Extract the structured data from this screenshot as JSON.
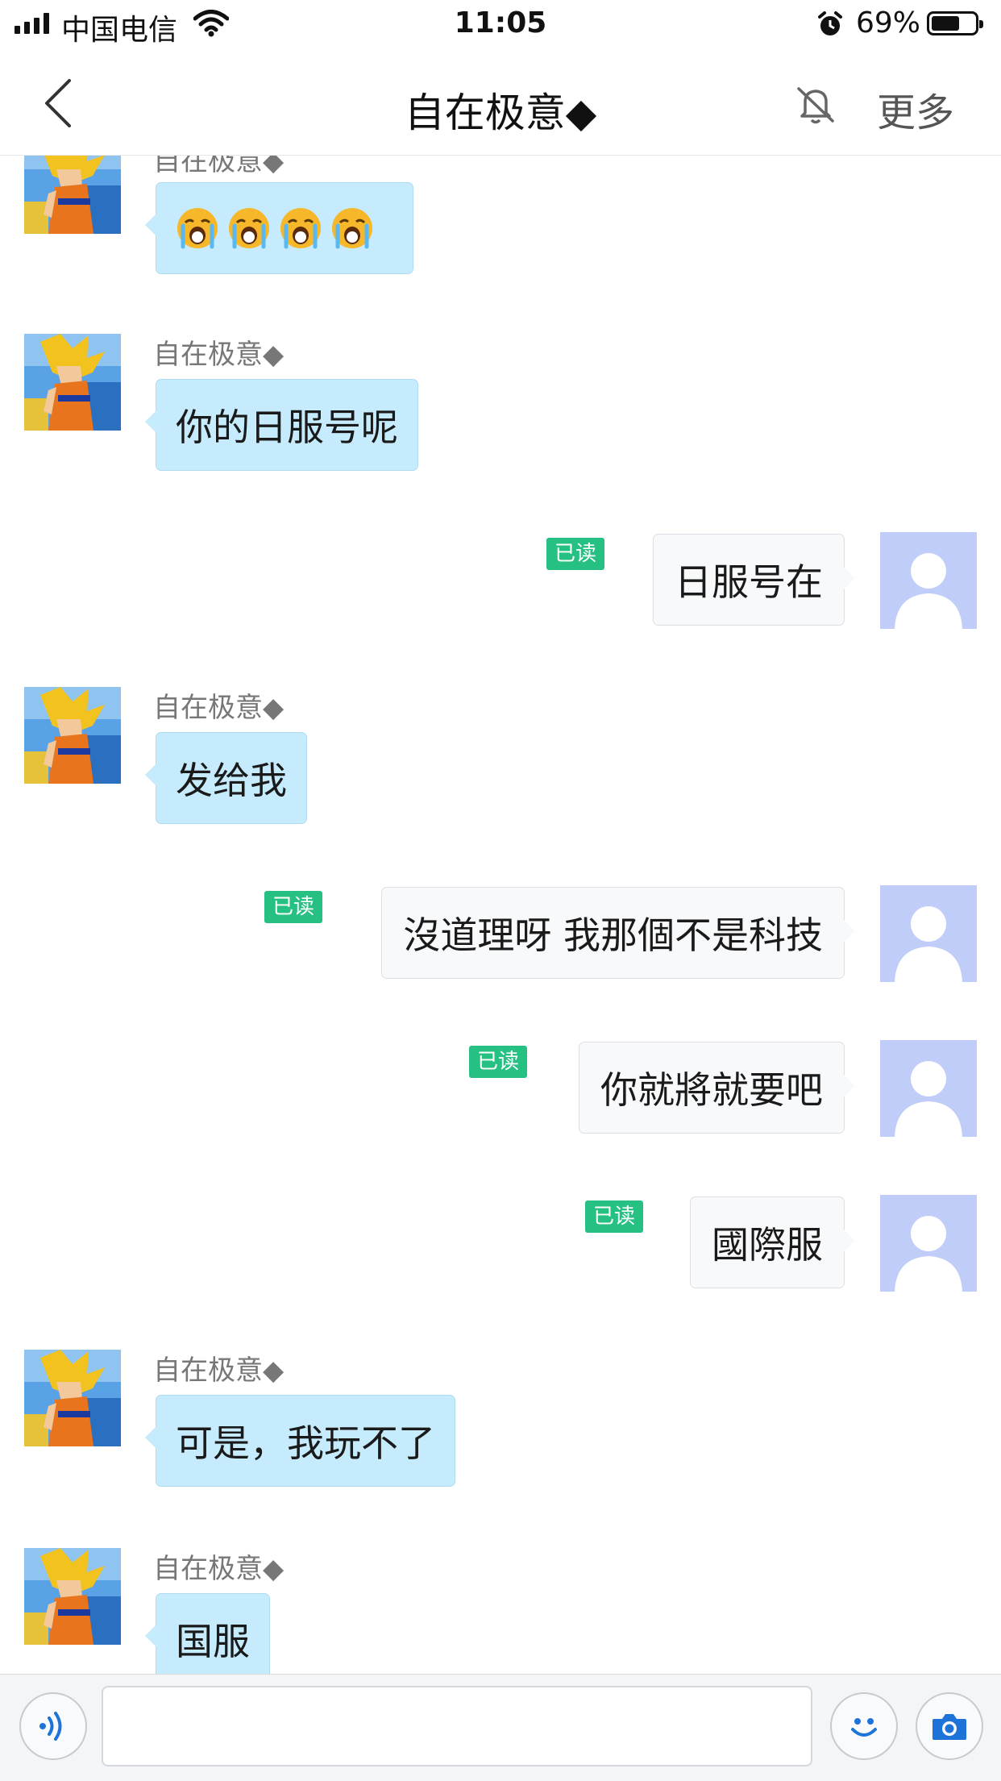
{
  "status_bar": {
    "carrier": "中国电信",
    "time": "11:05",
    "battery_percent": "69%",
    "battery_level": 0.69
  },
  "nav": {
    "back_icon": "chevron-left-icon",
    "title": "自在极意◆",
    "mute_icon": "bell-off-icon",
    "more_label": "更多"
  },
  "messages": [
    {
      "side": "in",
      "sender": "自在极意◆",
      "emoji": [
        "crying-face-icon",
        "crying-face-icon",
        "crying-face-icon",
        "crying-face-icon"
      ]
    },
    {
      "side": "in",
      "sender": "自在极意◆",
      "text": "你的日服号呢"
    },
    {
      "side": "out",
      "text": "日服号在",
      "status": "已读"
    },
    {
      "side": "in",
      "sender": "自在极意◆",
      "text": "发给我"
    },
    {
      "side": "out",
      "text": "沒道理呀 我那個不是科技",
      "status": "已读"
    },
    {
      "side": "out",
      "text": "你就將就要吧",
      "status": "已读"
    },
    {
      "side": "out",
      "text": "國際服",
      "status": "已读"
    },
    {
      "side": "in",
      "sender": "自在极意◆",
      "text": "可是，我玩不了"
    },
    {
      "side": "in",
      "sender": "自在极意◆",
      "text": "国服"
    }
  ],
  "input_bar": {
    "voice_icon": "voice-icon",
    "input_value": "",
    "emoji_icon": "smiley-icon",
    "camera_icon": "camera-icon"
  },
  "colors": {
    "incoming_bubble": "#c5ebfc",
    "outgoing_bubble": "#f8f9fb",
    "read_badge": "#27c083",
    "default_avatar": "#bfcdf8"
  }
}
